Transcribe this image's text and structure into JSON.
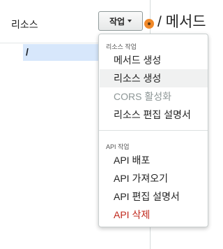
{
  "resources": {
    "title": "리소스",
    "tree": [
      {
        "path": "/"
      }
    ]
  },
  "header": {
    "actions_label": "작업",
    "method_title": "/ 메서드"
  },
  "menu": {
    "resource_group": {
      "title": "리소스 작업",
      "items": [
        {
          "label": "메서드 생성"
        },
        {
          "label": "리소스 생성"
        },
        {
          "label": "CORS 활성화"
        },
        {
          "label": "리소스 편집 설명서"
        }
      ]
    },
    "api_group": {
      "title": "API 작업",
      "items": [
        {
          "label": "API 배포"
        },
        {
          "label": "API 가져오기"
        },
        {
          "label": "API 편집 설명서"
        },
        {
          "label": "API 삭제"
        }
      ]
    }
  },
  "colors": {
    "selected_row": "#d7e7fb",
    "status_dot": "#f0892a",
    "danger": "#c0281c",
    "disabled": "#8d9696"
  },
  "icons": {
    "caret": "caret-down-icon",
    "status": "status-dot-icon"
  }
}
